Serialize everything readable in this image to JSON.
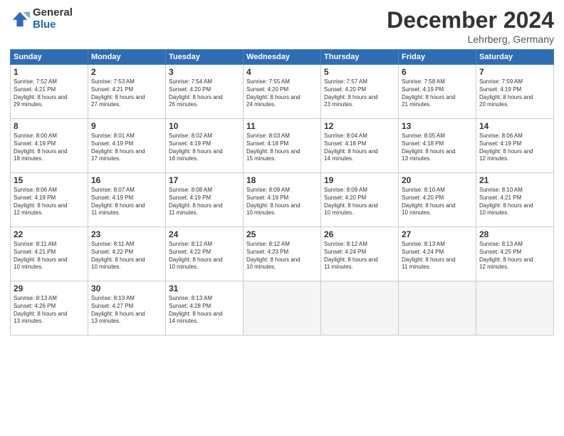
{
  "header": {
    "logo_general": "General",
    "logo_blue": "Blue",
    "title": "December 2024",
    "location": "Lehrberg, Germany"
  },
  "days_of_week": [
    "Sunday",
    "Monday",
    "Tuesday",
    "Wednesday",
    "Thursday",
    "Friday",
    "Saturday"
  ],
  "weeks": [
    [
      {
        "day": 1,
        "sunrise": "7:52 AM",
        "sunset": "4:21 PM",
        "daylight": "8 hours and 29 minutes."
      },
      {
        "day": 2,
        "sunrise": "7:53 AM",
        "sunset": "4:21 PM",
        "daylight": "8 hours and 27 minutes."
      },
      {
        "day": 3,
        "sunrise": "7:54 AM",
        "sunset": "4:20 PM",
        "daylight": "8 hours and 26 minutes."
      },
      {
        "day": 4,
        "sunrise": "7:55 AM",
        "sunset": "4:20 PM",
        "daylight": "8 hours and 24 minutes."
      },
      {
        "day": 5,
        "sunrise": "7:57 AM",
        "sunset": "4:20 PM",
        "daylight": "8 hours and 23 minutes."
      },
      {
        "day": 6,
        "sunrise": "7:58 AM",
        "sunset": "4:19 PM",
        "daylight": "8 hours and 21 minutes."
      },
      {
        "day": 7,
        "sunrise": "7:59 AM",
        "sunset": "4:19 PM",
        "daylight": "8 hours and 20 minutes."
      }
    ],
    [
      {
        "day": 8,
        "sunrise": "8:00 AM",
        "sunset": "4:19 PM",
        "daylight": "8 hours and 18 minutes."
      },
      {
        "day": 9,
        "sunrise": "8:01 AM",
        "sunset": "4:19 PM",
        "daylight": "8 hours and 17 minutes."
      },
      {
        "day": 10,
        "sunrise": "8:02 AM",
        "sunset": "4:19 PM",
        "daylight": "8 hours and 16 minutes."
      },
      {
        "day": 11,
        "sunrise": "8:03 AM",
        "sunset": "4:18 PM",
        "daylight": "8 hours and 15 minutes."
      },
      {
        "day": 12,
        "sunrise": "8:04 AM",
        "sunset": "4:18 PM",
        "daylight": "8 hours and 14 minutes."
      },
      {
        "day": 13,
        "sunrise": "8:05 AM",
        "sunset": "4:18 PM",
        "daylight": "8 hours and 13 minutes."
      },
      {
        "day": 14,
        "sunrise": "8:06 AM",
        "sunset": "4:19 PM",
        "daylight": "8 hours and 12 minutes."
      }
    ],
    [
      {
        "day": 15,
        "sunrise": "8:06 AM",
        "sunset": "4:19 PM",
        "daylight": "8 hours and 12 minutes."
      },
      {
        "day": 16,
        "sunrise": "8:07 AM",
        "sunset": "4:19 PM",
        "daylight": "8 hours and 11 minutes."
      },
      {
        "day": 17,
        "sunrise": "8:08 AM",
        "sunset": "4:19 PM",
        "daylight": "8 hours and 11 minutes."
      },
      {
        "day": 18,
        "sunrise": "8:09 AM",
        "sunset": "4:19 PM",
        "daylight": "8 hours and 10 minutes."
      },
      {
        "day": 19,
        "sunrise": "8:09 AM",
        "sunset": "4:20 PM",
        "daylight": "8 hours and 10 minutes."
      },
      {
        "day": 20,
        "sunrise": "8:10 AM",
        "sunset": "4:20 PM",
        "daylight": "8 hours and 10 minutes."
      },
      {
        "day": 21,
        "sunrise": "8:10 AM",
        "sunset": "4:21 PM",
        "daylight": "8 hours and 10 minutes."
      }
    ],
    [
      {
        "day": 22,
        "sunrise": "8:11 AM",
        "sunset": "4:21 PM",
        "daylight": "8 hours and 10 minutes."
      },
      {
        "day": 23,
        "sunrise": "8:11 AM",
        "sunset": "4:22 PM",
        "daylight": "8 hours and 10 minutes."
      },
      {
        "day": 24,
        "sunrise": "8:12 AM",
        "sunset": "4:22 PM",
        "daylight": "8 hours and 10 minutes."
      },
      {
        "day": 25,
        "sunrise": "8:12 AM",
        "sunset": "4:23 PM",
        "daylight": "8 hours and 10 minutes."
      },
      {
        "day": 26,
        "sunrise": "8:12 AM",
        "sunset": "4:24 PM",
        "daylight": "8 hours and 11 minutes."
      },
      {
        "day": 27,
        "sunrise": "8:13 AM",
        "sunset": "4:24 PM",
        "daylight": "8 hours and 11 minutes."
      },
      {
        "day": 28,
        "sunrise": "8:13 AM",
        "sunset": "4:25 PM",
        "daylight": "8 hours and 12 minutes."
      }
    ],
    [
      {
        "day": 29,
        "sunrise": "8:13 AM",
        "sunset": "4:26 PM",
        "daylight": "8 hours and 13 minutes."
      },
      {
        "day": 30,
        "sunrise": "8:13 AM",
        "sunset": "4:27 PM",
        "daylight": "8 hours and 13 minutes."
      },
      {
        "day": 31,
        "sunrise": "8:13 AM",
        "sunset": "4:28 PM",
        "daylight": "8 hours and 14 minutes."
      },
      null,
      null,
      null,
      null
    ]
  ]
}
